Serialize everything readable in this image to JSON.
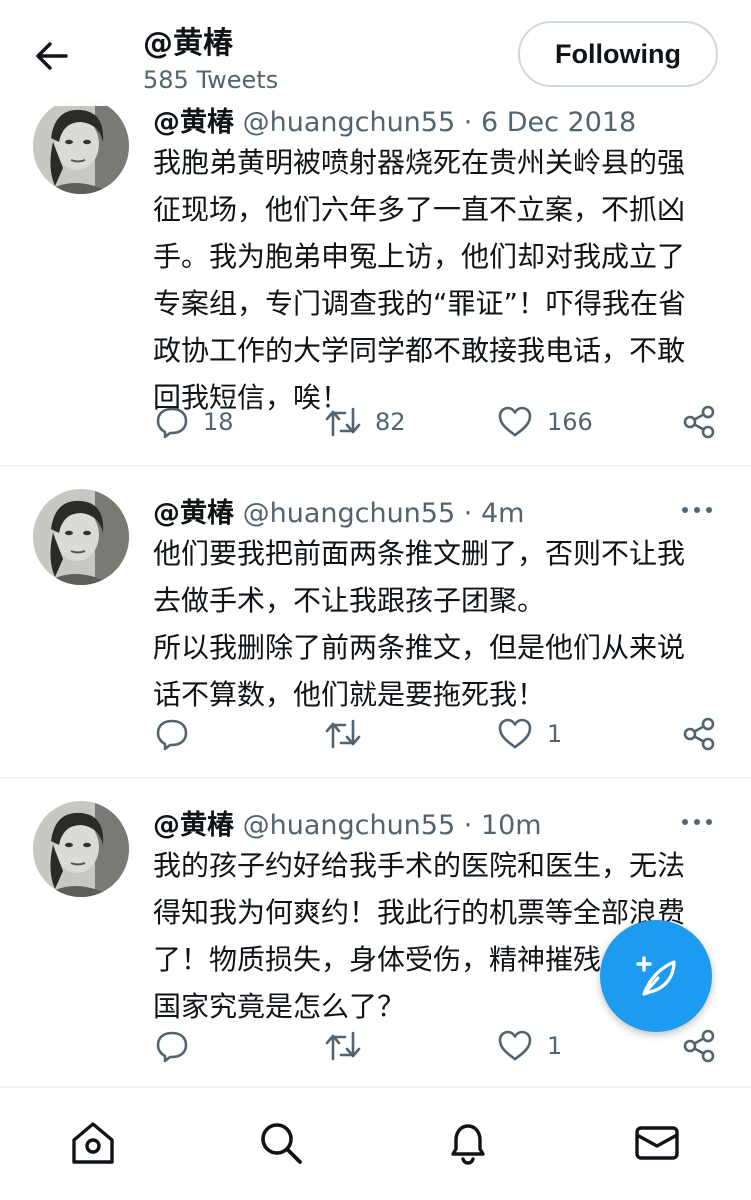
{
  "header": {
    "title": "@黄椿",
    "tweet_count": "585 Tweets",
    "follow_label": "Following"
  },
  "tweets": [
    {
      "name": "@黄椿",
      "handle": "@huangchun55",
      "separator": "·",
      "time": "6 Dec 2018",
      "text_lines": [
        "我胞弟黄明被喷射器烧死在贵州关岭县的强",
        "征现场，他们六年多了一直不立案，不抓凶",
        "手。我为胞弟申冤上访，他们却对我成立了",
        "专案组，专门调查我的“罪证”！吓得我在省",
        "政协工作的大学同学都不敢接我电话，不敢",
        "回我短信，唉！"
      ],
      "replies": "18",
      "retweets": "82",
      "likes": "166"
    },
    {
      "name": "@黄椿",
      "handle": "@huangchun55",
      "separator": "·",
      "time": "4m",
      "text_lines": [
        "他们要我把前面两条推文删了，否则不让我",
        "去做手术，不让我跟孩子团聚。",
        "所以我删除了前两条推文，但是他们从来说",
        "话不算数，他们就是要拖死我！"
      ],
      "replies": "",
      "retweets": "",
      "likes": "1"
    },
    {
      "name": "@黄椿",
      "handle": "@huangchun55",
      "separator": "·",
      "time": "10m",
      "text_lines": [
        "我的孩子约好给我手术的医院和医生，无法",
        "得知我为何爽约！我此行的机票等全部浪费",
        "了！物质损失，身体受伤，精神摧残，这个",
        "国家究竟是怎么了？"
      ],
      "replies": "",
      "retweets": "",
      "likes": "1"
    }
  ],
  "icons": {
    "back": "arrow-left-icon",
    "more": "more-dots-icon",
    "reply": "comment-icon",
    "retweet": "retweet-icon",
    "like": "heart-icon",
    "share": "share-icon",
    "compose": "compose-feather-icon",
    "nav": [
      "home-icon",
      "search-icon",
      "bell-icon",
      "mail-icon"
    ]
  },
  "colors": {
    "accent": "#1d9bf0",
    "text": "#0f1419",
    "muted": "#536471",
    "border": "#eff3f4"
  }
}
